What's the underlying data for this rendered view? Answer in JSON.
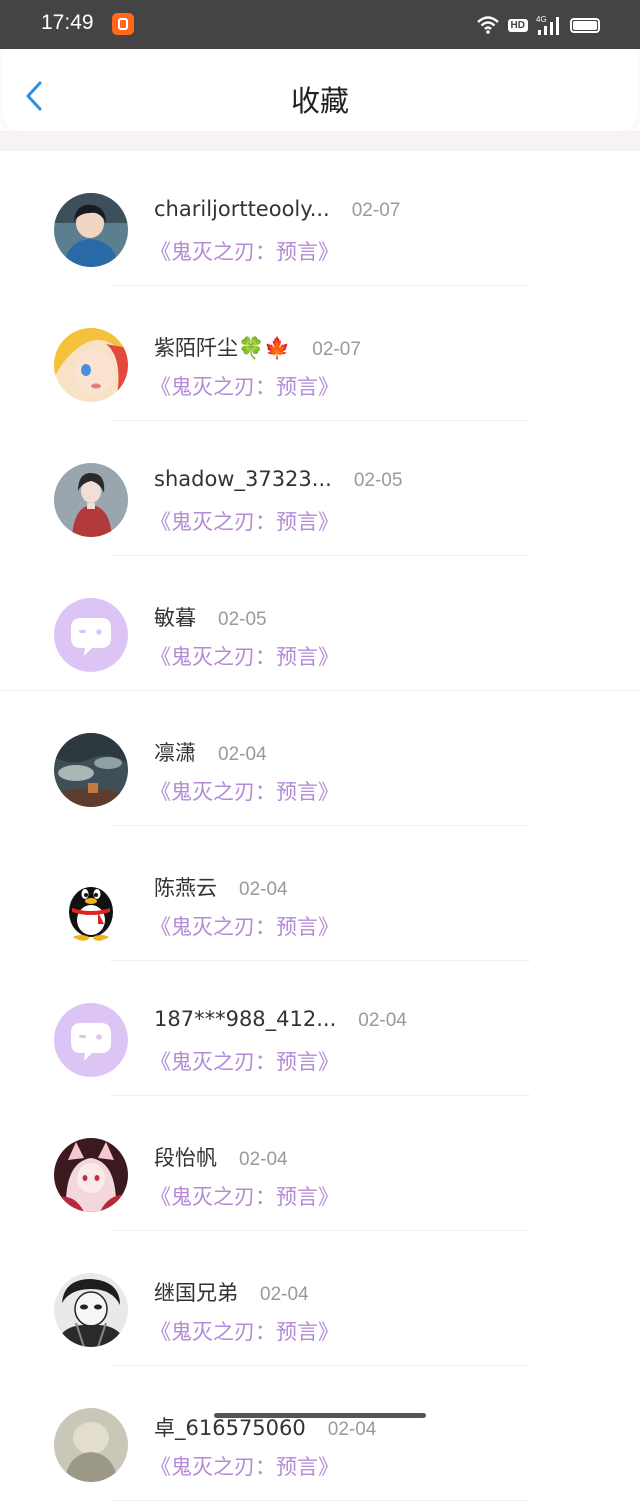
{
  "status_bar": {
    "time": "17:49",
    "hd": "HD",
    "network": "4G"
  },
  "header": {
    "title": "收藏"
  },
  "items": [
    {
      "name": "chariljortteooly...",
      "date": "02-07",
      "book": "《鬼灭之刃：预言》",
      "avatar": "avatar-blue-hoodie"
    },
    {
      "name": "紫陌阡尘🍀🍁",
      "date": "02-07",
      "book": "《鬼灭之刃：预言》",
      "avatar": "avatar-blonde-anime"
    },
    {
      "name": "shadow_37323...",
      "date": "02-05",
      "book": "《鬼灭之刃：预言》",
      "avatar": "avatar-red-dress"
    },
    {
      "name": "敏暮",
      "date": "02-05",
      "book": "《鬼灭之刃：预言》",
      "avatar": "avatar-default-chat"
    },
    {
      "name": "凛潇",
      "date": "02-04",
      "book": "《鬼灭之刃：预言》",
      "avatar": "avatar-painting"
    },
    {
      "name": "陈燕云",
      "date": "02-04",
      "book": "《鬼灭之刃：预言》",
      "avatar": "avatar-qq-penguin"
    },
    {
      "name": "187***988_412...",
      "date": "02-04",
      "book": "《鬼灭之刃：预言》",
      "avatar": "avatar-default-chat"
    },
    {
      "name": "段怡帆",
      "date": "02-04",
      "book": "《鬼灭之刃：预言》",
      "avatar": "avatar-fox-girl"
    },
    {
      "name": "继国兄弟",
      "date": "02-04",
      "book": "《鬼灭之刃：预言》",
      "avatar": "avatar-sketch"
    },
    {
      "name": "卓_616575060",
      "date": "02-04",
      "book": "《鬼灭之刃：预言》",
      "avatar": "avatar-partial"
    }
  ],
  "colors": {
    "book_title": "#b48ad6",
    "back_arrow": "#2e8fe0",
    "default_avatar": "#dcc4f4"
  }
}
